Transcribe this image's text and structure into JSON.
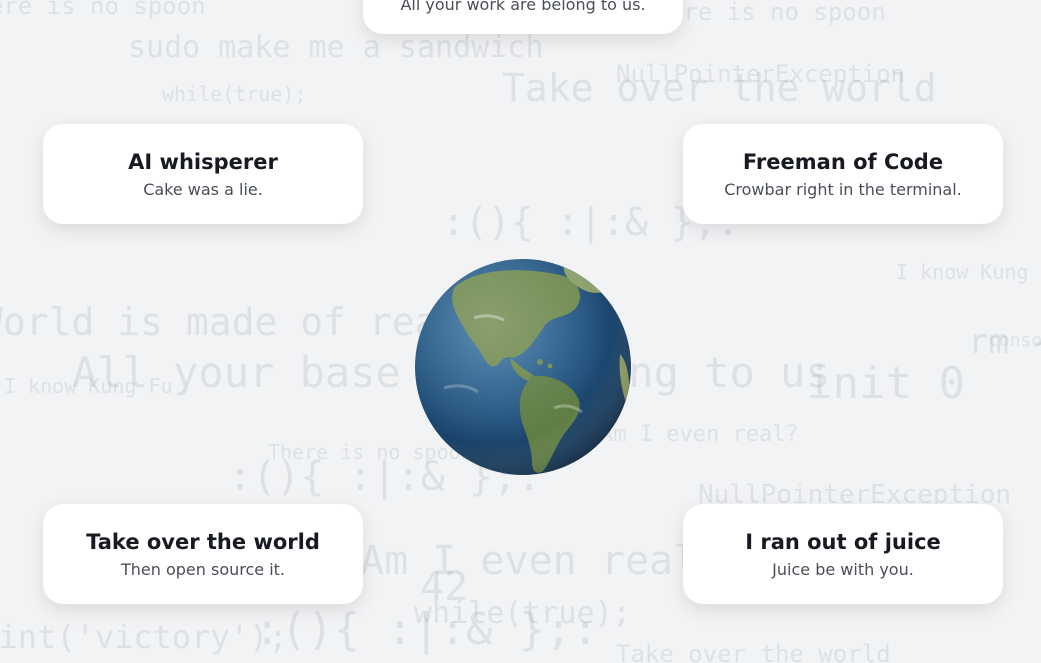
{
  "background_phrases": [
    "There is no spoon",
    "sudo make me a sandwich",
    "while(true);",
    "NullPointerException",
    "Take over the world",
    "There is no spoon",
    "World is made of real?",
    "All your base are belong to us",
    "I know Kung Fu",
    "init 0",
    "rm -rf /",
    ":(){ :|:& };:",
    "Am I even real?",
    "42",
    "print('victory');",
    "console.log"
  ],
  "cards": {
    "top": {
      "title": "",
      "subtitle": "All your work are belong to us."
    },
    "top_left": {
      "title": "AI whisperer",
      "subtitle": "Cake was a lie."
    },
    "top_right": {
      "title": "Freeman of Code",
      "subtitle": "Crowbar right in the terminal."
    },
    "bottom_left": {
      "title": "Take over the world",
      "subtitle": "Then open source it."
    },
    "bottom_right": {
      "title": "I ran out of juice",
      "subtitle": "Juice be with you."
    }
  },
  "globe": {
    "icon": "earth-globe-icon",
    "ocean_color": "#1f4f7a",
    "land_color": "#6f8a4f"
  }
}
